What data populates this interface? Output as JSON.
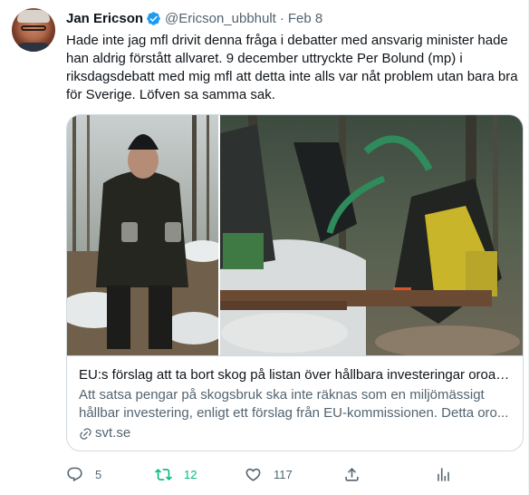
{
  "author": {
    "display_name": "Jan Ericson",
    "handle": "@Ericson_ubbhult",
    "separator": "·",
    "date": "Feb 8",
    "verified": true
  },
  "tweet": {
    "text": "Hade inte jag mfl drivit denna fråga i debatter med ansvarig minister hade han aldrig förstått allvaret. 9 december uttryckte Per Bolund (mp) i riksdagsdebatt med mig mfl att detta inte alls var nåt problem utan bara bra för Sverige. Löfven sa samma sak."
  },
  "card": {
    "title": "EU:s förslag att ta bort skog på listan över hållbara investeringar oroar ...",
    "description": "Att satsa pengar på skogsbruk ska inte räknas som en miljömässigt hållbar investering, enligt ett förslag från EU-kommissionen. Detta oro...",
    "domain": "svt.se",
    "image_icon": "forestry-harvester-photo"
  },
  "actions": {
    "reply": {
      "icon": "reply-icon",
      "count": "5"
    },
    "retweet": {
      "icon": "retweet-icon",
      "count": "12",
      "active": true
    },
    "like": {
      "icon": "like-icon",
      "count": "117"
    },
    "share": {
      "icon": "share-icon"
    },
    "analytics": {
      "icon": "analytics-icon"
    }
  },
  "colors": {
    "text_primary": "#0f1419",
    "text_secondary": "#536471",
    "verified_blue": "#1d9bf0",
    "retweet_green": "#00ba7c",
    "border": "#cfd9de"
  }
}
